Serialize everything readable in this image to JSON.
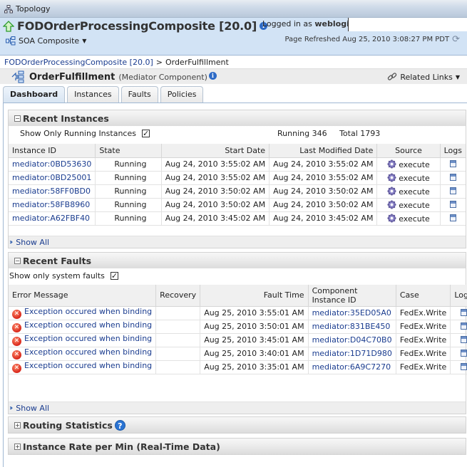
{
  "topbar": {
    "topology_label": "Topology"
  },
  "header": {
    "composite_title": "FODOrderProcessingComposite [20.0]",
    "soa_menu_label": "SOA Composite",
    "logged_in_prefix": "Logged in as",
    "username": "weblogic",
    "page_refreshed": "Page Refreshed Aug 25, 2010 3:08:27 PM PDT"
  },
  "breadcrumb": {
    "items": [
      "FODOrderProcessingComposite [20.0]",
      "OrderFulfillment"
    ],
    "separator": ">"
  },
  "component": {
    "name": "OrderFulfillment",
    "type": "(Mediator Component)",
    "related_links_label": "Related Links"
  },
  "tabs": [
    {
      "label": "Dashboard",
      "active": true
    },
    {
      "label": "Instances",
      "active": false
    },
    {
      "label": "Faults",
      "active": false
    },
    {
      "label": "Policies",
      "active": false
    }
  ],
  "recent_instances": {
    "title": "Recent Instances",
    "filter_label": "Show Only Running Instances",
    "filter_checked": true,
    "running_label": "Running",
    "running_count": "346",
    "total_label": "Total",
    "total_count": "1793",
    "columns": [
      "Instance ID",
      "State",
      "Start Date",
      "Last Modified Date",
      "Source",
      "Logs"
    ],
    "rows": [
      {
        "id": "mediator:0BD53630",
        "state": "Running",
        "start": "Aug 24, 2010 3:55:02 AM",
        "modified": "Aug 24, 2010 3:55:02 AM",
        "source": "execute"
      },
      {
        "id": "mediator:0BD25001",
        "state": "Running",
        "start": "Aug 24, 2010 3:55:02 AM",
        "modified": "Aug 24, 2010 3:55:02 AM",
        "source": "execute"
      },
      {
        "id": "mediator:58FF0BD0",
        "state": "Running",
        "start": "Aug 24, 2010 3:50:02 AM",
        "modified": "Aug 24, 2010 3:50:02 AM",
        "source": "execute"
      },
      {
        "id": "mediator:58FB8960",
        "state": "Running",
        "start": "Aug 24, 2010 3:50:02 AM",
        "modified": "Aug 24, 2010 3:50:02 AM",
        "source": "execute"
      },
      {
        "id": "mediator:A62FBF40",
        "state": "Running",
        "start": "Aug 24, 2010 3:45:02 AM",
        "modified": "Aug 24, 2010 3:45:02 AM",
        "source": "execute"
      }
    ],
    "show_all_label": "Show All"
  },
  "recent_faults": {
    "title": "Recent Faults",
    "filter_label": "Show only system faults",
    "filter_checked": true,
    "columns": [
      "Error Message",
      "Recovery",
      "Fault Time",
      "Component Instance ID",
      "Case",
      "Logs"
    ],
    "rows": [
      {
        "message": "Exception occured when binding",
        "recovery": "",
        "time": "Aug 25, 2010 3:55:01 AM",
        "instance": "mediator:35ED05A0",
        "case": "FedEx.Write"
      },
      {
        "message": "Exception occured when binding",
        "recovery": "",
        "time": "Aug 25, 2010 3:50:01 AM",
        "instance": "mediator:831BE450",
        "case": "FedEx.Write"
      },
      {
        "message": "Exception occured when binding",
        "recovery": "",
        "time": "Aug 25, 2010 3:45:01 AM",
        "instance": "mediator:D04C70B0",
        "case": "FedEx.Write"
      },
      {
        "message": "Exception occured when binding",
        "recovery": "",
        "time": "Aug 25, 2010 3:40:01 AM",
        "instance": "mediator:1D71D980",
        "case": "FedEx.Write"
      },
      {
        "message": "Exception occured when binding",
        "recovery": "",
        "time": "Aug 25, 2010 3:35:01 AM",
        "instance": "mediator:6A9C7270",
        "case": "FedEx.Write"
      }
    ],
    "show_all_label": "Show All"
  },
  "routing_statistics": {
    "title": "Routing Statistics"
  },
  "instance_rate": {
    "title": "Instance Rate per Min (Real-Time Data)"
  },
  "icons": {
    "check": "✓",
    "error": "✕",
    "help": "?",
    "info": "i",
    "expand": "+",
    "collapse": "−",
    "caret": "▼",
    "refresh": "⟳",
    "show_all": "»"
  }
}
